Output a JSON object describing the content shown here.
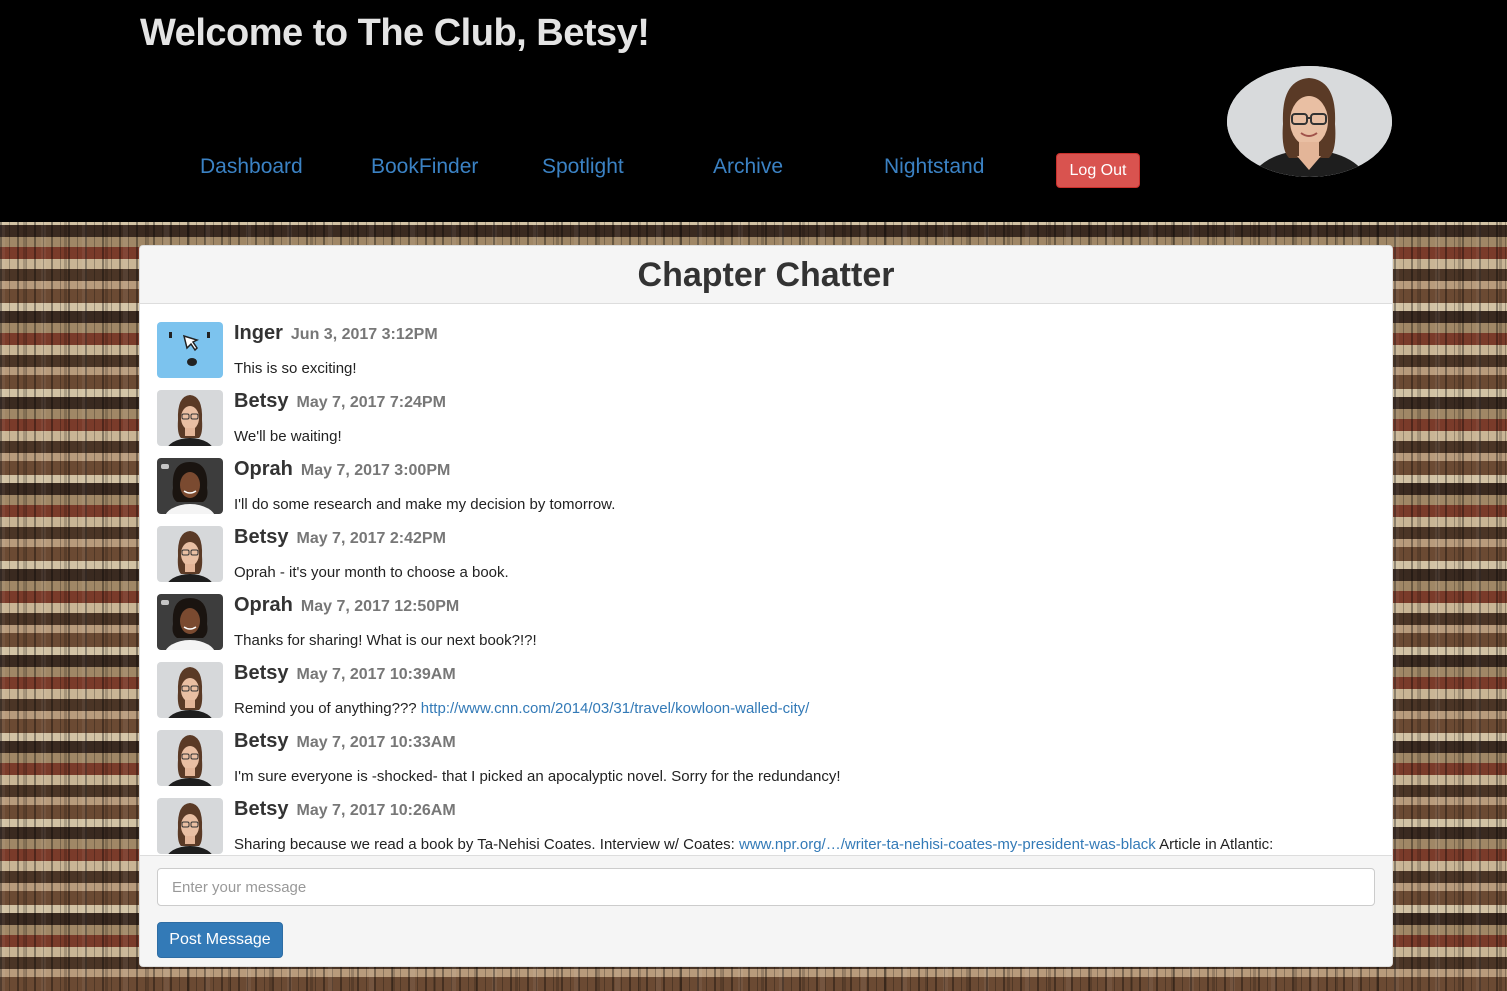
{
  "header": {
    "welcome": "Welcome to The Club, Betsy!",
    "nav": [
      "Dashboard",
      "BookFinder",
      "Spotlight",
      "Archive",
      "Nightstand"
    ],
    "logout": "Log Out"
  },
  "chat": {
    "title": "Chapter Chatter",
    "messages": [
      {
        "name": "Inger",
        "date": "Jun 3, 2017 3:12PM",
        "text": "This is so exciting!",
        "avatar": "cartoon-face"
      },
      {
        "name": "Betsy",
        "date": "May 7, 2017 7:24PM",
        "text": "We'll be waiting!",
        "avatar": "betsy"
      },
      {
        "name": "Oprah",
        "date": "May 7, 2017 3:00PM",
        "text": "I'll do some research and make my decision by tomorrow.",
        "avatar": "oprah"
      },
      {
        "name": "Betsy",
        "date": "May 7, 2017 2:42PM",
        "text": "Oprah - it's your month to choose a book.",
        "avatar": "betsy"
      },
      {
        "name": "Oprah",
        "date": "May 7, 2017 12:50PM",
        "text": "Thanks for sharing! What is our next book?!?!",
        "avatar": "oprah"
      },
      {
        "name": "Betsy",
        "date": "May 7, 2017 10:39AM",
        "text": "Remind you of anything???",
        "link": "http://www.cnn.com/2014/03/31/travel/kowloon-walled-city/",
        "avatar": "betsy"
      },
      {
        "name": "Betsy",
        "date": "May 7, 2017 10:33AM",
        "text": "I'm sure everyone is -shocked- that I picked an apocalyptic novel. Sorry for the redundancy!",
        "avatar": "betsy"
      },
      {
        "name": "Betsy",
        "date": "May 7, 2017 10:26AM",
        "text": "Sharing because we read a book by Ta-Nehisi Coates. Interview w/ Coates:",
        "link": "www.npr.org/…/writer-ta-nehisi-coates-my-president-was-black",
        "text_after": "Article in Atlantic:",
        "avatar": "betsy"
      }
    ],
    "input_placeholder": "Enter your message",
    "post_button": "Post Message"
  },
  "colors": {
    "link": "#337ab7",
    "nav_link": "#3b82c4",
    "logout": "#d9534f",
    "post_button": "#337ab7"
  }
}
